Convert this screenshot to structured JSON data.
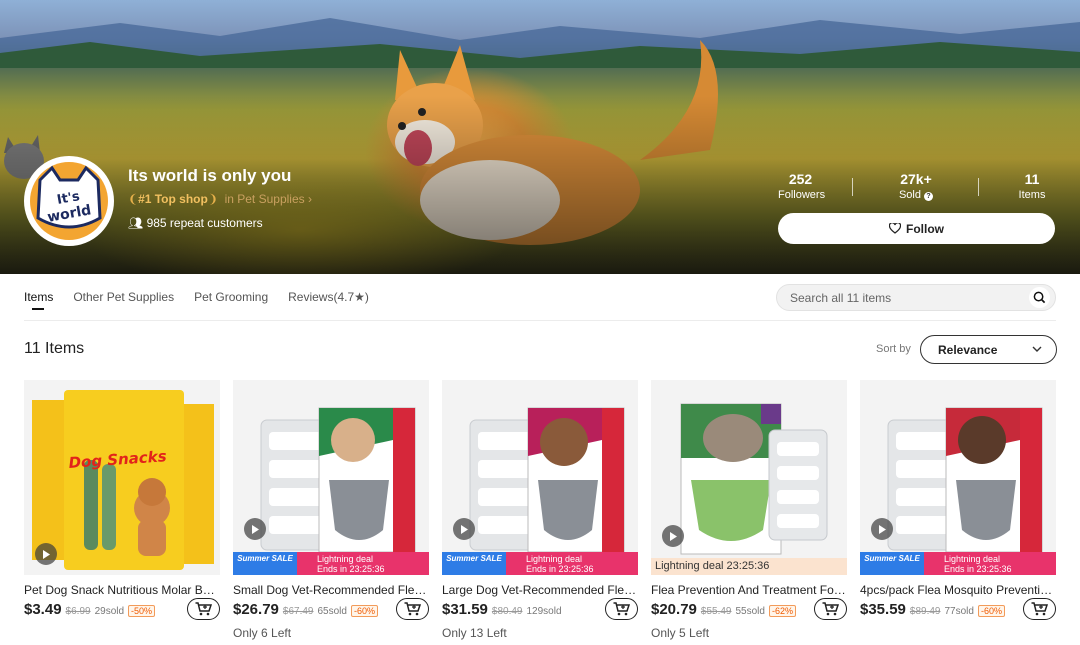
{
  "shop": {
    "name": "Its world is only you",
    "rank_badge": "#1 Top shop",
    "rank_category": "in Pet Supplies",
    "repeat_customers": "985 repeat customers",
    "logo_text": "It's world"
  },
  "stats": [
    {
      "value": "252",
      "label": "Followers"
    },
    {
      "value": "27k+",
      "label": "Sold"
    },
    {
      "value": "11",
      "label": "Items"
    }
  ],
  "follow_label": "Follow",
  "tabs": [
    "Items",
    "Other Pet Supplies",
    "Pet Grooming",
    "Reviews(4.7★)"
  ],
  "search": {
    "placeholder": "Search all 11 items"
  },
  "items_count": "11 Items",
  "sort": {
    "label": "Sort by",
    "value": "Relevance"
  },
  "products": [
    {
      "title": "Pet Dog Snack Nutritious Molar Bon...",
      "price": "$3.49",
      "old_price": "$6.99",
      "sold": "29sold",
      "discount": "-50%",
      "stock": "",
      "package_text": "Dog Snacks"
    },
    {
      "title": "Small Dog Vet-Recommended Flea, ...",
      "price": "$26.79",
      "old_price": "$67.49",
      "sold": "65sold",
      "discount": "-60%",
      "stock": "Only 6 Left",
      "promo": "Summer SALE",
      "deal": "Lightning deal",
      "ends": "Ends in 23:25:36"
    },
    {
      "title": "Large Dog Vet-Recommended Flea, ...",
      "price": "$31.59",
      "old_price": "$80.49",
      "sold": "129sold",
      "discount": "",
      "stock": "Only 13 Left",
      "promo": "Summer SALE",
      "deal": "Lightning deal",
      "ends": "Ends in 23:25:36"
    },
    {
      "title": "Flea Prevention And Treatment For L...",
      "price": "$20.79",
      "old_price": "$55.49",
      "sold": "55sold",
      "discount": "-62%",
      "stock": "Only 5 Left",
      "deal_inline": "Lightning deal  23:25:36"
    },
    {
      "title": "4pcs/pack Flea Mosquito Prevention...",
      "price": "$35.59",
      "old_price": "$89.49",
      "sold": "77sold",
      "discount": "-60%",
      "stock": "",
      "promo": "Summer SALE",
      "deal": "Lightning deal",
      "ends": "Ends in 23:25:36"
    }
  ],
  "colors": {
    "promo_blue": "#2e7ce6",
    "deal_pink": "#e8336b",
    "discount_orange": "#f05a00"
  }
}
